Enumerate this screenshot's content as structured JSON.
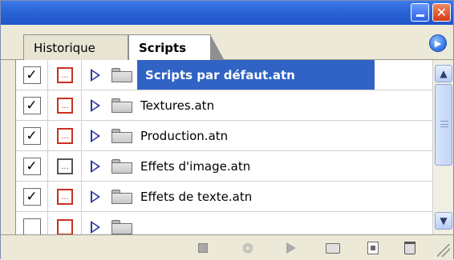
{
  "window": {
    "minimize_label": "_",
    "close_label": "✕",
    "minimize_icon": "minimize-icon",
    "close_icon": "close-icon",
    "titlebar_color": "#2a63d6"
  },
  "tabs": [
    {
      "label": "Historique",
      "active": false
    },
    {
      "label": "Scripts",
      "active": true
    }
  ],
  "panel_menu_icon": "panel-menu-arrow-icon",
  "panel_menu_label": "▶",
  "actions": [
    {
      "label": "Scripts par défaut.atn",
      "checked": true,
      "dialog": "red",
      "selected": true
    },
    {
      "label": "Textures.atn",
      "checked": true,
      "dialog": "red",
      "selected": false
    },
    {
      "label": "Production.atn",
      "checked": true,
      "dialog": "red",
      "selected": false
    },
    {
      "label": "Effets d'image.atn",
      "checked": true,
      "dialog": "gray",
      "selected": false
    },
    {
      "label": "Effets de texte.atn",
      "checked": true,
      "dialog": "red",
      "selected": false
    }
  ],
  "row_icons": {
    "check_mark": "✓",
    "dialog_dots": "...",
    "expand_icon": "expand-triangle-icon",
    "folder_icon": "folder-icon"
  },
  "scrollbar": {
    "up_label": "▲",
    "down_label": "▼",
    "position": 0.0
  },
  "toolbar": {
    "stop_icon": "stop-icon",
    "record_icon": "record-icon",
    "record_label": "❂",
    "play_icon": "play-icon",
    "new_set_icon": "new-set-icon",
    "new_action_icon": "new-action-icon",
    "delete_icon": "trash-icon"
  },
  "colors": {
    "selection": "#3163c5",
    "dialog_red": "#c8311f",
    "triangle": "#2d35a0"
  }
}
